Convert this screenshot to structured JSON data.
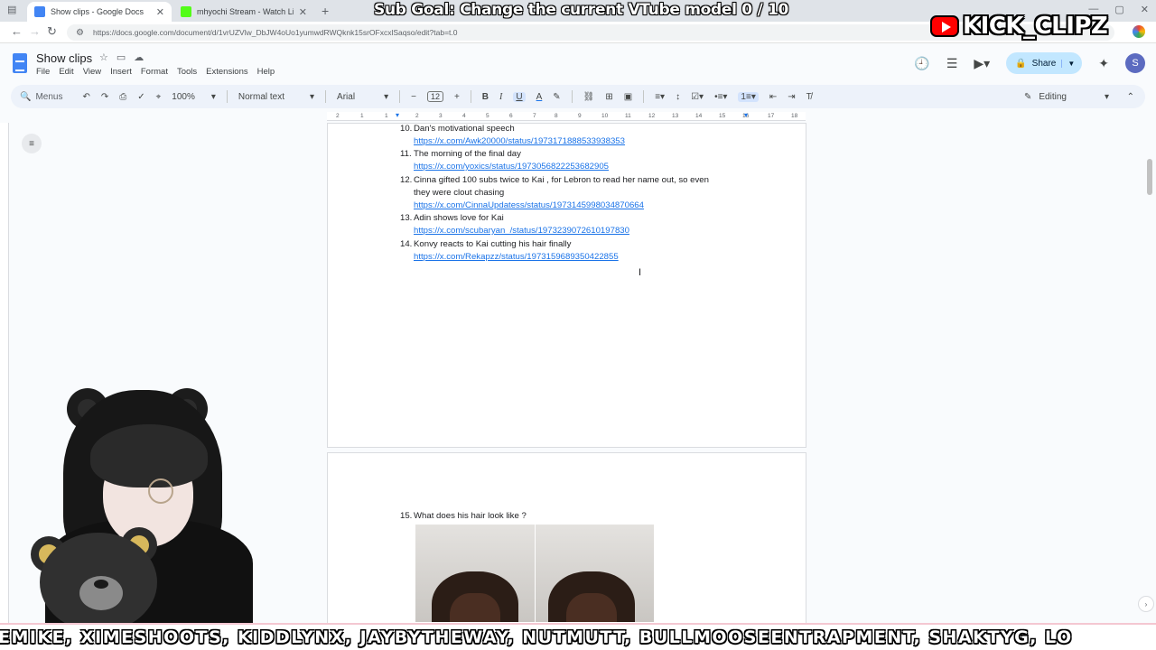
{
  "browser": {
    "tabs": [
      {
        "title": "Show clips - Google Docs",
        "active": true,
        "color": "#4285f4"
      },
      {
        "title": "mhyochi Stream - Watch Live on K",
        "active": false,
        "color": "#53fc18"
      }
    ],
    "url": "https://docs.google.com/document/d/1vrUZVlw_DbJW4oUo1yumwdRWQknk15srOFxcxlSaqso/edit?tab=t.0"
  },
  "doc": {
    "title": "Show clips",
    "menu": [
      "File",
      "Edit",
      "View",
      "Insert",
      "Format",
      "Tools",
      "Extensions",
      "Help"
    ],
    "share_label": "Share",
    "avatar_letter": "S"
  },
  "toolbar": {
    "menus_label": "Menus",
    "zoom": "100%",
    "style": "Normal text",
    "font": "Arial",
    "font_size": "12",
    "mode": "Editing"
  },
  "ruler": [
    "2",
    "1",
    "1",
    "2",
    "3",
    "4",
    "5",
    "6",
    "7",
    "8",
    "9",
    "10",
    "11",
    "12",
    "13",
    "14",
    "15",
    "16",
    "17",
    "18"
  ],
  "list_items": [
    {
      "num": "10.",
      "text": "Dan's motivational speech",
      "link": "https://x.com/Awk20000/status/1973171888533938353"
    },
    {
      "num": "11.",
      "text": "The morning of the final day",
      "link": "https://x.com/yoxics/status/1973056822253682905"
    },
    {
      "num": "12.",
      "text": "Cinna gifted 100 subs twice to Kai , for Lebron to read her name out, so even",
      "text2": "they were clout chasing",
      "link": "https://x.com/CinnaUpdatess/status/1973145998034870664"
    },
    {
      "num": "13.",
      "text": "Adin shows love for Kai",
      "link": "https://x.com/scubaryan_/status/1973239072610197830"
    },
    {
      "num": "14.",
      "text": "Konvy reacts to Kai cutting his hair finally",
      "link": "https://x.com/Rekapzz/status/1973159689350422855"
    },
    {
      "num": "15.",
      "text": "What does his hair look like ?"
    }
  ],
  "overlay": {
    "subgoal": "Sub Goal: Change the current VTube model  0 / 10",
    "brand": "KICK_CLIPZ",
    "ticker": "EMIKE, XIMESHOOTS, KIDDLYNX, JAYBYTHEWAY, NUTMUTT, BULLMOOSEENTRAPMENT, SHAKTYG, LO"
  }
}
